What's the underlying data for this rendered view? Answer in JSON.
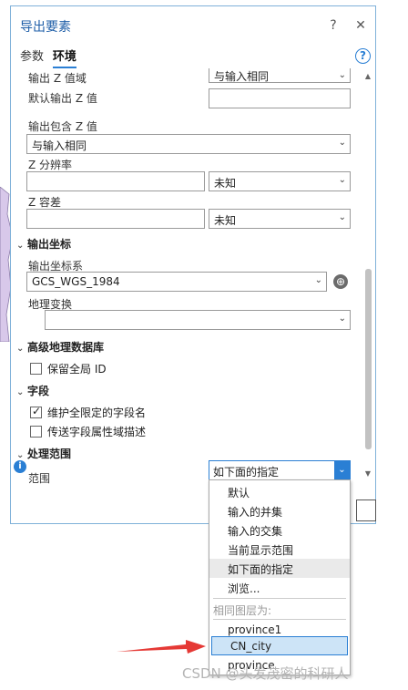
{
  "pane": {
    "title": "导出要素",
    "help_glyph": "?",
    "close_glyph": "✕",
    "tabs": [
      "参数",
      "环境"
    ],
    "active_tab": "环境"
  },
  "fields": {
    "output_z_domain": {
      "label": "输出 Z 值域",
      "value": "与输入相同"
    },
    "default_output_z": {
      "label": "默认输出 Z 值",
      "value": ""
    },
    "output_has_z": {
      "label": "输出包含 Z 值",
      "value": "与输入相同"
    },
    "z_resolution": {
      "label": "Z 分辨率",
      "value": "",
      "unit": "未知"
    },
    "z_tolerance": {
      "label": "Z 容差",
      "value": "",
      "unit": "未知"
    }
  },
  "sections": {
    "output_coords": "输出坐标",
    "advanced_gdb": "高级地理数据库",
    "fields": "字段",
    "extent": "处理范围"
  },
  "coords": {
    "system_label": "输出坐标系",
    "system_value": "GCS_WGS_1984",
    "transform_label": "地理变换",
    "transform_value": ""
  },
  "checkboxes": {
    "preserve_global_id": {
      "label": "保留全局 ID",
      "checked": false
    },
    "maintain_qualified": {
      "label": "维护全限定的字段名",
      "checked": true
    },
    "transfer_domain": {
      "label": "传送字段属性域描述",
      "checked": false
    }
  },
  "extent": {
    "label": "范围",
    "selected": "如下面的指定"
  },
  "dropdown": {
    "options": [
      "默认",
      "输入的并集",
      "输入的交集",
      "当前显示范围",
      "如下面的指定",
      "浏览..."
    ],
    "highlighted": "如下面的指定",
    "group_header": "相同图层为:",
    "layers": [
      "province1",
      "CN_city",
      "province"
    ],
    "selected_layer": "CN_city"
  },
  "watermark": "CSDN @头发茂密的科研人",
  "colors": {
    "accent": "#2a7fd4",
    "title": "#1f5fa8",
    "arrow": "#e53935"
  }
}
